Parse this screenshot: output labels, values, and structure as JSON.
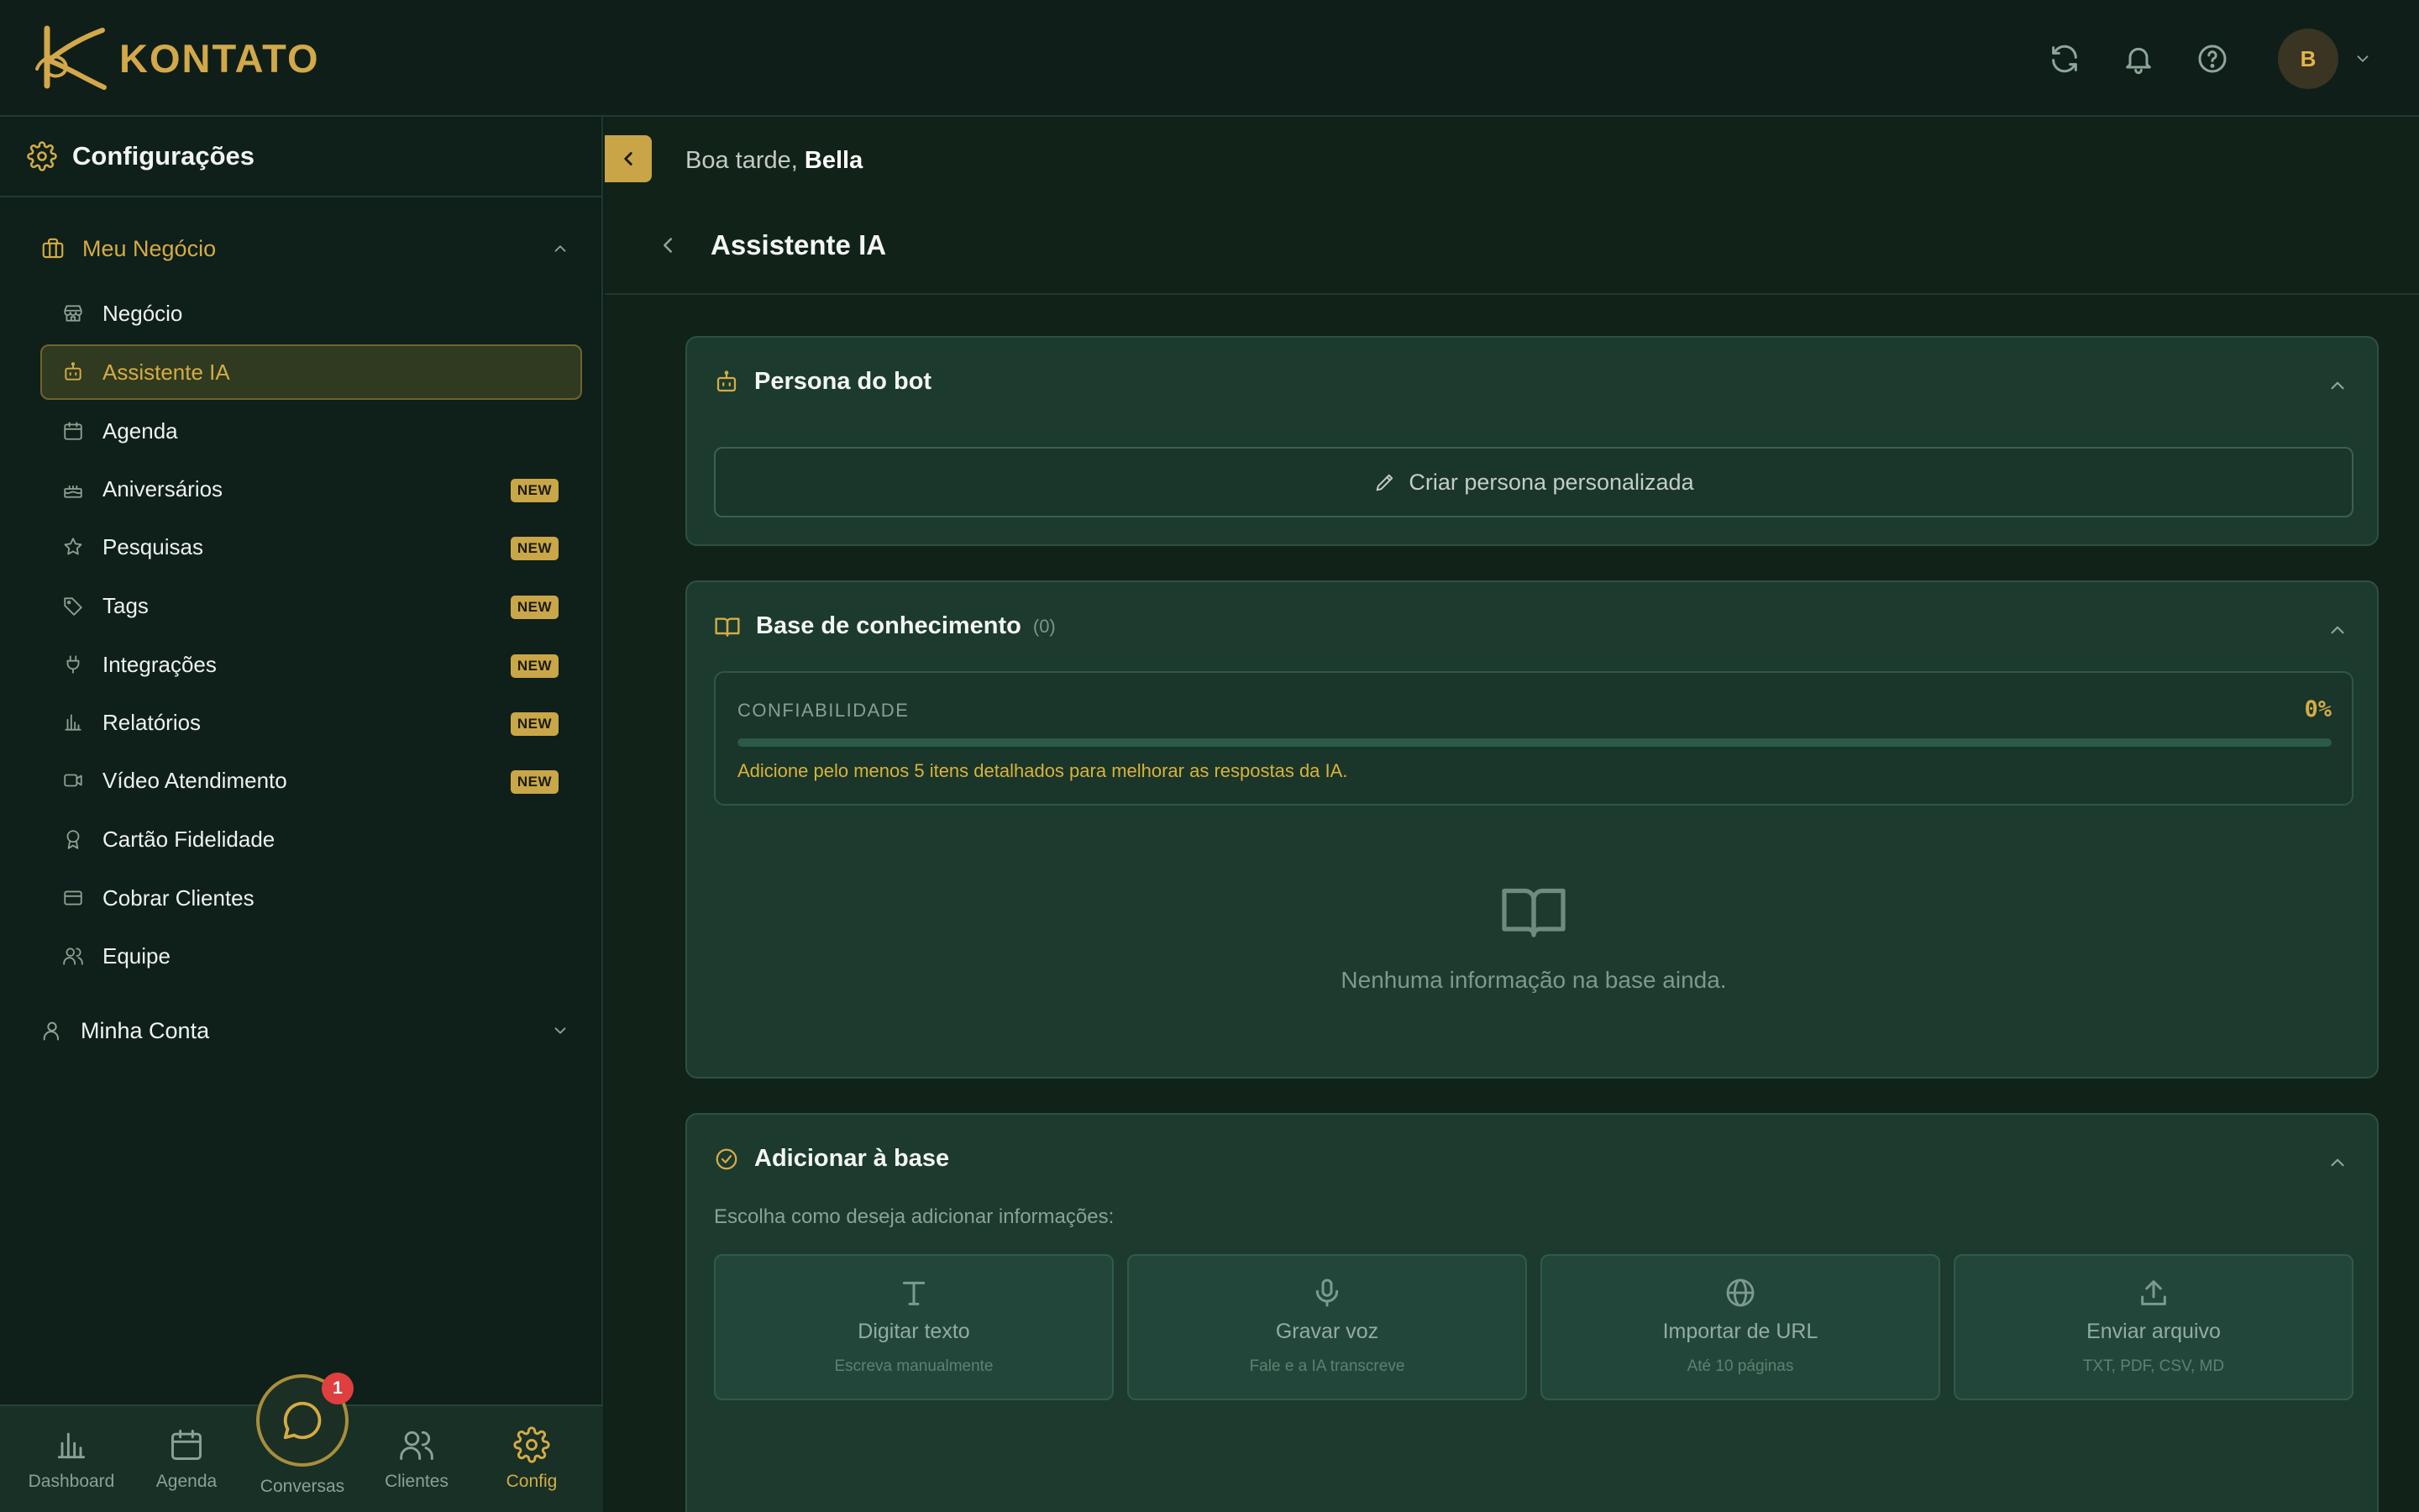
{
  "app": {
    "logo_text": "KONTATO",
    "avatar_initial": "B"
  },
  "sidebar": {
    "title": "Configurações",
    "group_business": "Meu Negócio",
    "items": [
      {
        "label": "Negócio",
        "badge": ""
      },
      {
        "label": "Assistente IA",
        "badge": ""
      },
      {
        "label": "Agenda",
        "badge": ""
      },
      {
        "label": "Aniversários",
        "badge": "NEW"
      },
      {
        "label": "Pesquisas",
        "badge": "NEW"
      },
      {
        "label": "Tags",
        "badge": "NEW"
      },
      {
        "label": "Integrações",
        "badge": "NEW"
      },
      {
        "label": "Relatórios",
        "badge": "NEW"
      },
      {
        "label": "Vídeo Atendimento",
        "badge": "NEW"
      },
      {
        "label": "Cartão Fidelidade",
        "badge": ""
      },
      {
        "label": "Cobrar Clientes",
        "badge": ""
      },
      {
        "label": "Equipe",
        "badge": ""
      }
    ],
    "group_account": "Minha Conta"
  },
  "bottom_nav": {
    "dashboard": "Dashboard",
    "agenda": "Agenda",
    "conversas": "Conversas",
    "conversas_badge": "1",
    "clientes": "Clientes",
    "config": "Config"
  },
  "header": {
    "greeting_prefix": "Boa tarde,",
    "user_name": "Bella",
    "page_title": "Assistente IA"
  },
  "persona_card": {
    "title": "Persona do bot",
    "button_label": "Criar persona personalizada"
  },
  "knowledge_card": {
    "title": "Base de conhecimento",
    "count": "(0)",
    "reliability_label": "CONFIABILIDADE",
    "reliability_value": "0%",
    "reliability_fraction": 0,
    "hint": "Adicione pelo menos 5 itens detalhados para melhorar as respostas da IA.",
    "empty_text": "Nenhuma informação na base ainda."
  },
  "add_card": {
    "title": "Adicionar à base",
    "subtitle": "Escolha como deseja adicionar informações:",
    "options": [
      {
        "title": "Digitar texto",
        "subtitle": "Escreva manualmente",
        "icon": "text-icon"
      },
      {
        "title": "Gravar voz",
        "subtitle": "Fale e a IA transcreve",
        "icon": "mic-icon"
      },
      {
        "title": "Importar de URL",
        "subtitle": "Até 10 páginas",
        "icon": "globe-icon"
      },
      {
        "title": "Enviar arquivo",
        "subtitle": "TXT, PDF, CSV, MD",
        "icon": "upload-icon"
      }
    ]
  },
  "colors": {
    "accent": "#d4ac45",
    "background": "#0f1f19",
    "card": "#1c3a2e"
  }
}
